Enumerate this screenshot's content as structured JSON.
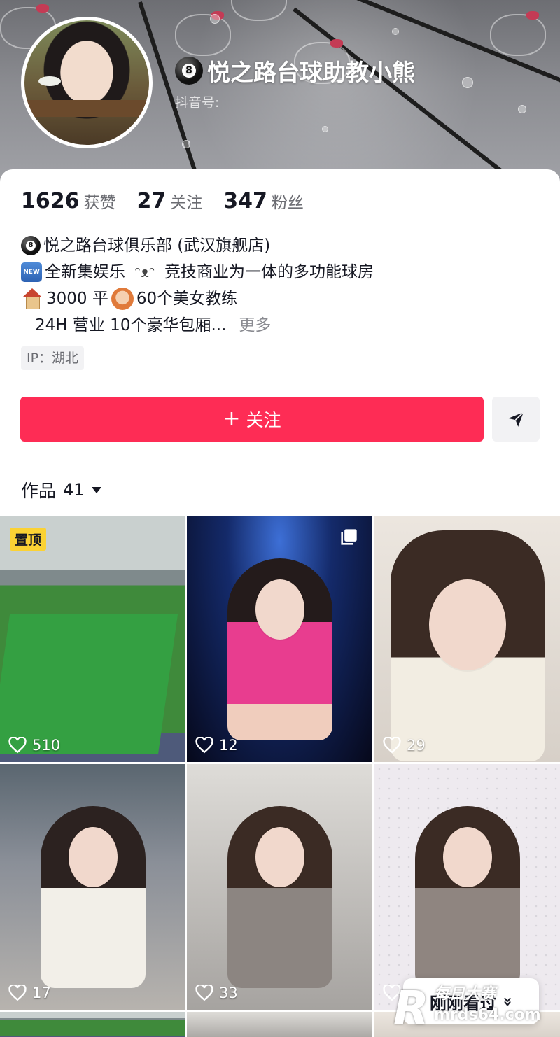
{
  "profile": {
    "name": "悦之路台球助教小熊",
    "douyin_id_label": "抖音号:",
    "ball_number": "8"
  },
  "stats": [
    {
      "value": "1626",
      "label": "获赞"
    },
    {
      "value": "27",
      "label": "关注"
    },
    {
      "value": "347",
      "label": "粉丝"
    }
  ],
  "bio": {
    "line1": "悦之路台球俱乐部 (武汉旗舰店)",
    "line2_badge": "NEW",
    "line2": "全新集娱乐",
    "line2_face": "ᵔᴥᵔ",
    "line2_rest": "竞技商业为一体的多功能球房",
    "line3_a": "3000 平",
    "line3_b": "60个美女教练",
    "line4": "24H 营业 10个豪华包厢...",
    "more": "更多"
  },
  "ip": "IP：湖北",
  "actions": {
    "follow_plus": "+",
    "follow_label": "关注"
  },
  "works": {
    "label": "作品",
    "count": "41"
  },
  "videos": [
    {
      "likes": "510",
      "badge": "置顶"
    },
    {
      "likes": "12"
    },
    {
      "likes": "29"
    },
    {
      "likes": "17"
    },
    {
      "likes": "33"
    },
    {
      "likes": ""
    }
  ],
  "overlay": {
    "recent_label": "刚刚看过",
    "chevron": "»"
  },
  "watermark": {
    "letter": "R",
    "text_cn": "每日大赛",
    "url": "mrds64.com"
  },
  "colors": {
    "primary": "#fe2c55",
    "pin_badge": "#fbd234",
    "text": "#161823",
    "muted": "#6b6c72"
  }
}
